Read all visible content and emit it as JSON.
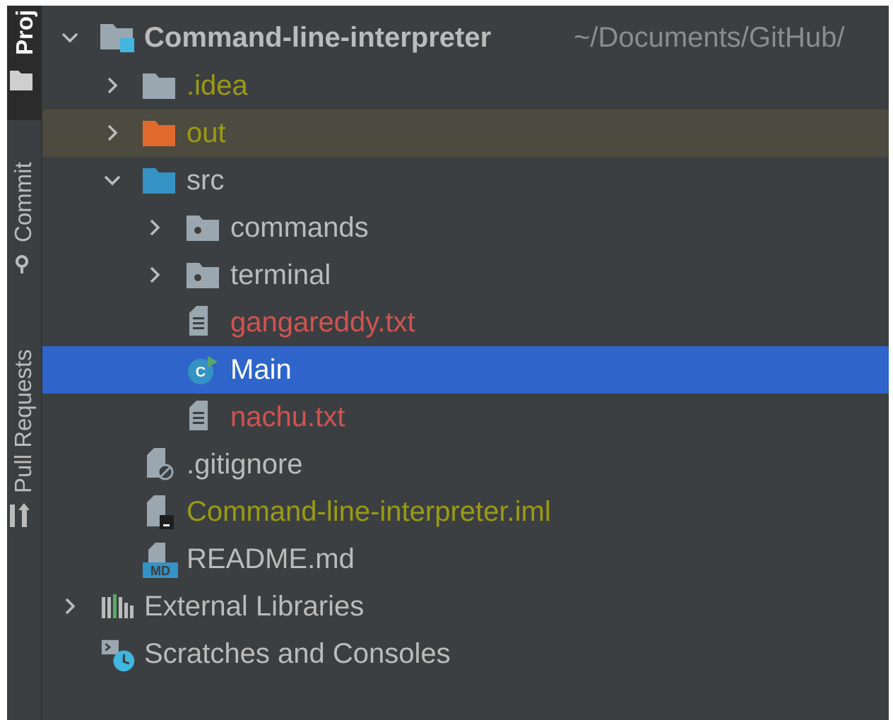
{
  "sidebar": {
    "tabs": [
      {
        "label": "Proj",
        "icon": "folder-icon",
        "active": true
      },
      {
        "label": "Commit",
        "icon": "commit-icon",
        "active": false
      },
      {
        "label": "Pull Requests",
        "icon": "pull-request-icon",
        "active": false
      }
    ]
  },
  "tree": {
    "root": {
      "label": "Command-line-interpreter",
      "path": "~/Documents/GitHub/",
      "icon": "module-folder-icon",
      "expanded": true
    },
    "items": [
      {
        "label": ".idea",
        "icon": "folder-icon",
        "expanded": false,
        "status": "ignored"
      },
      {
        "label": "out",
        "icon": "excluded-folder-icon",
        "expanded": false,
        "status": "excluded"
      },
      {
        "label": "src",
        "icon": "source-folder-icon",
        "expanded": true
      },
      {
        "label": "commands",
        "icon": "package-icon",
        "expanded": false
      },
      {
        "label": "terminal",
        "icon": "package-icon",
        "expanded": false
      },
      {
        "label": "gangareddy.txt",
        "icon": "text-file-icon",
        "status": "unversioned"
      },
      {
        "label": "Main",
        "icon": "java-class-runnable-icon",
        "selected": true
      },
      {
        "label": "nachu.txt",
        "icon": "text-file-icon",
        "status": "unversioned"
      },
      {
        "label": ".gitignore",
        "icon": "gitignore-file-icon"
      },
      {
        "label": "Command-line-interpreter.iml",
        "icon": "iml-file-icon",
        "status": "ignored"
      },
      {
        "label": "README.md",
        "icon": "markdown-file-icon"
      },
      {
        "label": "External Libraries",
        "icon": "libraries-icon",
        "expanded": false
      },
      {
        "label": "Scratches and Consoles",
        "icon": "scratches-icon"
      }
    ]
  },
  "colors": {
    "background": "#3c3f41",
    "selection": "#2f65ca",
    "modified_row": "#4d4a3f",
    "ignored_text": "#9a9a15",
    "unversioned_text": "#d25252",
    "default_text": "#bbbbbb"
  }
}
